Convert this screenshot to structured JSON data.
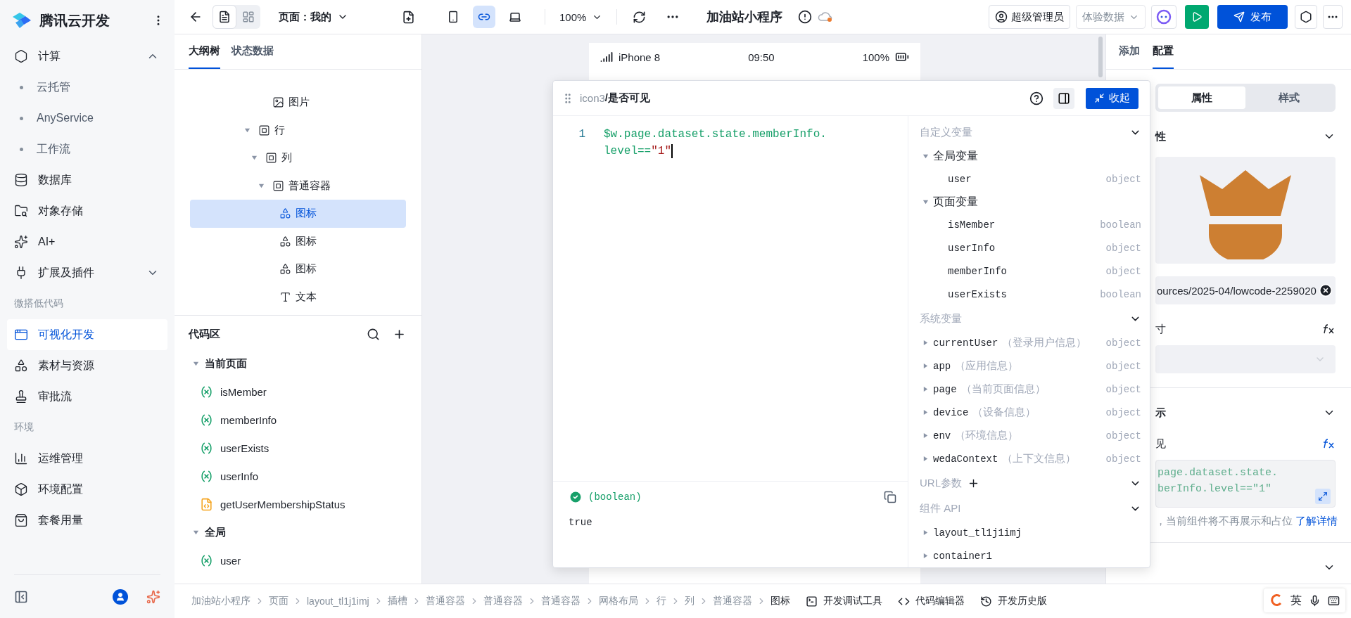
{
  "sidebar": {
    "brand": "腾讯云开发",
    "items": [
      {
        "kind": "item",
        "label": "计算",
        "expanded": true,
        "selected": false
      },
      {
        "kind": "sub",
        "label": "云托管",
        "selected": false
      },
      {
        "kind": "sub",
        "label": "AnyService",
        "selected": false
      },
      {
        "kind": "sub",
        "label": "工作流",
        "selected": false
      },
      {
        "kind": "item",
        "label": "数据库",
        "selected": false
      },
      {
        "kind": "item",
        "label": "对象存储",
        "selected": false
      },
      {
        "kind": "item",
        "label": "AI+",
        "selected": false
      },
      {
        "kind": "item",
        "label": "扩展及插件",
        "expanded": false,
        "selected": false
      },
      {
        "kind": "section",
        "label": "微搭低代码"
      },
      {
        "kind": "item",
        "label": "可视化开发",
        "selected": true
      },
      {
        "kind": "item",
        "label": "素材与资源",
        "selected": false
      },
      {
        "kind": "item",
        "label": "审批流",
        "selected": false
      },
      {
        "kind": "section",
        "label": "环境"
      },
      {
        "kind": "item",
        "label": "运维管理",
        "selected": false
      },
      {
        "kind": "item",
        "label": "环境配置",
        "selected": false
      },
      {
        "kind": "item",
        "label": "套餐用量",
        "selected": false
      }
    ]
  },
  "toolbar": {
    "views": [
      {
        "selected": true
      },
      {
        "selected": false
      }
    ],
    "page_select": "页面：我的",
    "devices": [
      {
        "selected": false
      },
      {
        "selected": true
      },
      {
        "selected": false
      }
    ],
    "zoom": "100%",
    "title": "加油站小程序",
    "role": "超级管理员",
    "data_select": "体验数据",
    "publish": "发布"
  },
  "outline": {
    "tabs": [
      {
        "label": "大纲树",
        "selected": true
      },
      {
        "label": "状态数据",
        "selected": false
      }
    ],
    "tree": [
      {
        "children": [
          {
            "children": [
              {
                "label": "图片",
                "kind": "image",
                "selected": false
              }
            ]
          }
        ]
      },
      {
        "label": "行",
        "kind": "container",
        "expanded": true,
        "selected": false,
        "children": [
          {
            "label": "列",
            "kind": "container",
            "expanded": true,
            "selected": false,
            "children": [
              {
                "label": "普通容器",
                "kind": "container",
                "expanded": true,
                "selected": false,
                "children": [
                  {
                    "label": "图标",
                    "kind": "icon",
                    "selected": true
                  },
                  {
                    "label": "图标",
                    "kind": "icon",
                    "selected": false
                  },
                  {
                    "label": "图标",
                    "kind": "icon",
                    "selected": false
                  },
                  {
                    "label": "文本",
                    "kind": "text",
                    "selected": false
                  }
                ]
              }
            ]
          }
        ]
      }
    ]
  },
  "code_area": {
    "title": "代码区",
    "groups": [
      {
        "label": "当前页面",
        "expanded": true,
        "items": [
          {
            "kind": "variable",
            "name": "isMember"
          },
          {
            "kind": "variable",
            "name": "memberInfo"
          },
          {
            "kind": "variable",
            "name": "userExists"
          },
          {
            "kind": "variable",
            "name": "userInfo"
          },
          {
            "kind": "function",
            "name": "getUserMembershipStatus"
          }
        ]
      },
      {
        "label": "全局",
        "expanded": true,
        "items": [
          {
            "kind": "variable",
            "name": "user"
          }
        ]
      }
    ]
  },
  "phone": {
    "model": "iPhone 8",
    "time": "09:50",
    "battery": "100%"
  },
  "popup": {
    "path_prefix": "icon3",
    "path_title": "/是否可见",
    "collapse_button": "收起",
    "editor": {
      "line_number": "1",
      "segments": [
        {
          "kind": "expr",
          "text": "$w.page.dataset.state.memberInfo.level=="
        },
        {
          "kind": "string",
          "text": "\"1\""
        }
      ]
    },
    "result": {
      "valid": true,
      "type": "(boolean)",
      "value": "true"
    },
    "sections": [
      {
        "title": "自定义变量",
        "groups": [
          {
            "label": "全局变量",
            "expanded": true,
            "items": [
              {
                "name": "user",
                "type": "object"
              }
            ]
          },
          {
            "label": "页面变量",
            "expanded": true,
            "items": [
              {
                "name": "isMember",
                "type": "boolean"
              },
              {
                "name": "userInfo",
                "type": "object"
              },
              {
                "name": "memberInfo",
                "type": "object"
              },
              {
                "name": "userExists",
                "type": "boolean"
              }
            ]
          }
        ]
      },
      {
        "title": "系统变量",
        "items": [
          {
            "name": "currentUser",
            "note": "（登录用户信息）",
            "type": "object",
            "expanded": false
          },
          {
            "name": "app",
            "note": "（应用信息）",
            "type": "object",
            "expanded": false
          },
          {
            "name": "page",
            "note": "（当前页面信息）",
            "type": "object",
            "expanded": false
          },
          {
            "name": "device",
            "note": "（设备信息）",
            "type": "object",
            "expanded": false
          },
          {
            "name": "env",
            "note": "（环境信息）",
            "type": "object",
            "expanded": false
          },
          {
            "name": "wedaContext",
            "note": "（上下文信息）",
            "type": "object",
            "expanded": false
          }
        ]
      },
      {
        "title": "URL参数",
        "addable": true
      },
      {
        "title": "组件 API",
        "items": [
          {
            "name": "layout_tl1j1imj",
            "expanded": false
          },
          {
            "name": "container1",
            "expanded": false
          }
        ]
      }
    ]
  },
  "config": {
    "tabs": [
      {
        "label": "添加",
        "selected": false
      },
      {
        "label": "配置",
        "selected": true
      }
    ],
    "segments": [
      {
        "label": "属性",
        "selected": true
      },
      {
        "label": "样式",
        "selected": false
      }
    ],
    "section_1": "性",
    "image_url": "ources/2025-04/lowcode-2259020",
    "size_label": "寸",
    "section_2": "示",
    "visible_label": "见",
    "visible_code": [
      "page.dataset.state.",
      "berInfo.level==\"1\""
    ],
    "hint": "，当前组件将不再展示和占位",
    "hint_link": "了解详情"
  },
  "bottom": {
    "breadcrumb": [
      "加油站小程序",
      "页面",
      "layout_tl1j1imj",
      "插槽",
      "普通容器",
      "普通容器",
      "普通容器",
      "网格布局",
      "行",
      "列",
      "普通容器",
      "图标"
    ],
    "tools": [
      "开发调试工具",
      "代码编辑器",
      "开发历史版"
    ],
    "ime": "英"
  }
}
